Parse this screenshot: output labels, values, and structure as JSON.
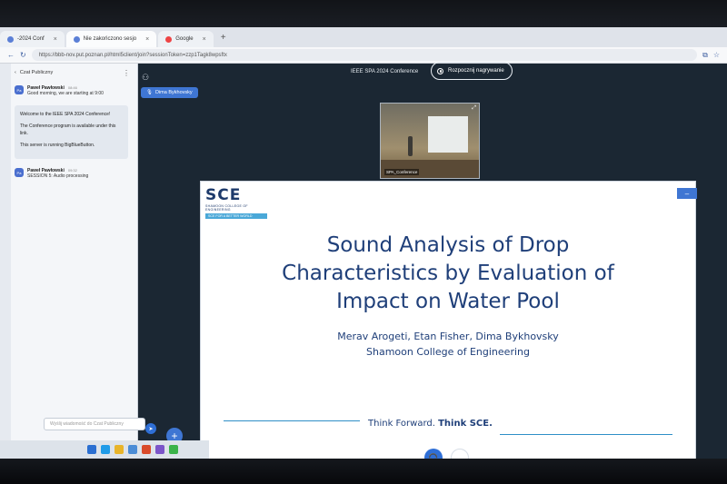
{
  "browser": {
    "tabs": [
      {
        "label": "-2024 Conf"
      },
      {
        "label": "Nie zakończono sesjo"
      },
      {
        "label": "Google"
      }
    ],
    "url": "https://bbb-nov.put.poznan.pl/html5client/join?sessionToken=zzp1Tagk8wpsftx"
  },
  "chat": {
    "header": "Czat Publiczny",
    "messages": [
      {
        "avatar": "Pa",
        "name": "Paweł Pawłowski",
        "time": "08:46",
        "text": "Good morning, we are starting at 9:00"
      },
      {
        "avatar": "Pa",
        "name": "Paweł Pawłowski",
        "time": "09:32",
        "text": "SESSION 5: Audio processing"
      }
    ],
    "welcome": [
      "Welcome to the IEEE SPA 2024 Conference!",
      "The Conference program is available under this link.",
      "This server is running BigBlueButton."
    ],
    "input_placeholder": "Wyślij wiadomość do Czat Publiczny"
  },
  "meeting": {
    "title": "IEEE SPA 2024 Conference",
    "record_label": "Rozpocznij nagrywanie",
    "speaker": "Dima Bykhovsky",
    "webcam_label": "SPA_Conference"
  },
  "slide": {
    "logo": "SCE",
    "logo_sub": "SHAMOON COLLEGE OF ENGINEERING",
    "logo_tag": "SCE FOR A BETTER WORLD",
    "title_lines": [
      "Sound Analysis of Drop",
      "Characteristics by Evaluation of",
      "Impact on Water Pool"
    ],
    "authors": "Merav Arogeti, Etan Fisher, Dima Bykhovsky",
    "affiliation": "Shamoon College of Engineering",
    "footer_a": "Think Forward. ",
    "footer_b": "Think SCE."
  },
  "icons": {
    "audio": "headphones-icon",
    "screenshare": "screen-share-icon",
    "plus": "plus-icon",
    "users": "users-icon"
  },
  "colors": {
    "accent": "#3f76d3",
    "slide_text": "#1f3f79",
    "stage_bg": "#1b2733"
  }
}
